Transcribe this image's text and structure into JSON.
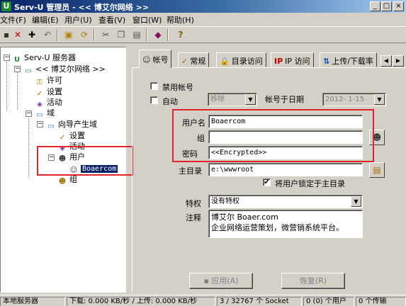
{
  "window": {
    "title": "Serv-U 管理员 - << 博艾尔网络 >>",
    "app_icon": "U",
    "accent": "#0a246a"
  },
  "menu": [
    "文件(F)",
    "编辑(E)",
    "用户(U)",
    "查看(V)",
    "窗口(W)",
    "帮助(H)"
  ],
  "toolbar": {
    "help_glyph": "?"
  },
  "tree": {
    "root": "Serv-U 服务器",
    "server": "<< 博艾尔网络 >>",
    "license": "许可",
    "settings": "设置",
    "activity": "活动",
    "domain": "域",
    "wizard_domain": "向导产生域",
    "wizard_settings": "设置",
    "wizard_activity": "活动",
    "users": "用户",
    "selected_user": "Boaercom",
    "groups": "组"
  },
  "tabs": [
    "帐号",
    "常规",
    "目录访问",
    "IP 访问",
    "上传/下载率"
  ],
  "account": {
    "disable_account_label": "禁用帐号",
    "auto_label": "自动",
    "auto_action": "移除",
    "expire_label": "帐号于日期",
    "expire_date": "2012- 1-15",
    "username_label": "用户名",
    "username": "Boaercom",
    "group_label": "组",
    "group": "",
    "password_label": "密码",
    "password": "<<Encrypted>>",
    "home_label": "主目录",
    "home": "e:\\wwwroot",
    "lock_home_label": "将用户锁定于主目录",
    "lock_home_checked": true,
    "privilege_label": "特权",
    "privilege": "没有特权",
    "notes_label": "注释",
    "notes_line1": "博艾尔 Boaer.com",
    "notes_line2": "企业网络运营策划，微营销系统平台。",
    "apply_label": "应用(A)",
    "revert_label": "恢复(R)"
  },
  "status": {
    "server": "本地服务器",
    "transfer": "下载: 0.000 KB/秒 / 上传: 0.000 KB/秒",
    "sockets": "3 / 32767 个 Socket",
    "users": "0 (0) 个用户",
    "transfers": "0 个传输"
  }
}
